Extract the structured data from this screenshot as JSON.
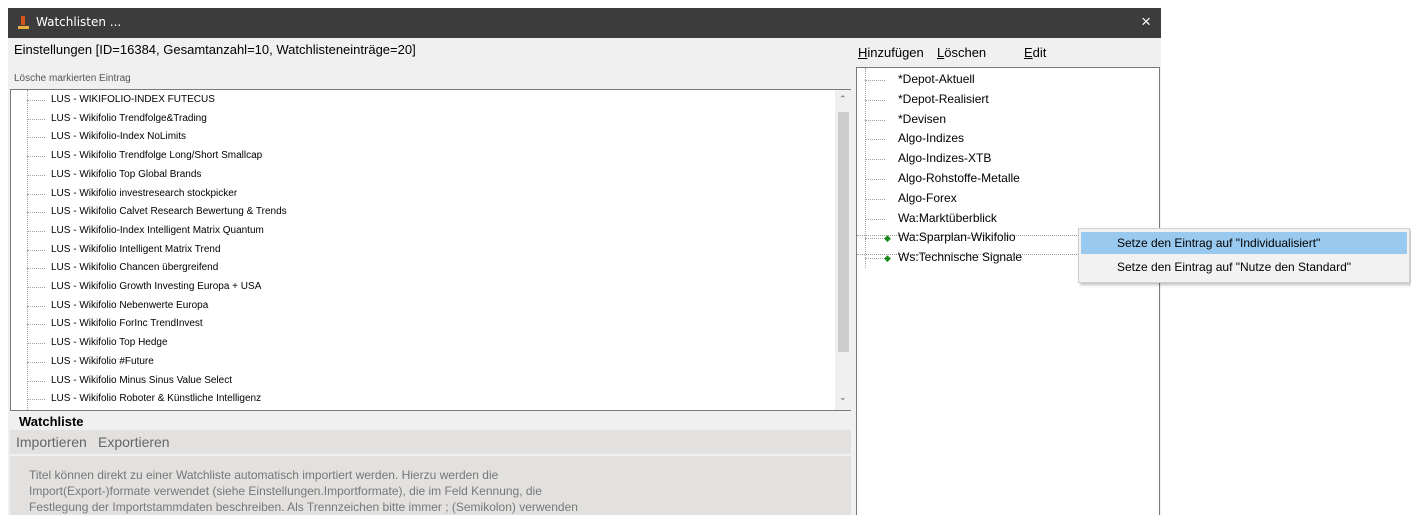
{
  "window": {
    "title": "Watchlisten ...",
    "close_icon": "×"
  },
  "settings": {
    "header": "Einstellungen [ID=16384, Gesamtanzahl=10, Watchlisteneinträge=20]",
    "delete_marked": "Lösche markierten Eintrag"
  },
  "entries": [
    "LUS - WIKIFOLIO-INDEX FUTECUS",
    "LUS - Wikifolio Trendfolge&Trading",
    "LUS - Wikifolio-Index NoLimits",
    "LUS - Wikifolio Trendfolge Long/Short Smallcap",
    "LUS - Wikifolio Top Global Brands",
    "LUS - Wikifolio investresearch stockpicker",
    "LUS - Wikifolio Calvet Research Bewertung & Trends",
    "LUS - Wikifolio-Index Intelligent Matrix Quantum",
    "LUS - Wikifolio Intelligent Matrix Trend",
    "LUS - Wikifolio Chancen übergreifend",
    "LUS - Wikifolio Growth Investing Europa + USA",
    "LUS - Wikifolio Nebenwerte Europa",
    "LUS - Wikifolio ForInc TrendInvest",
    "LUS - Wikifolio Top Hedge",
    "LUS - Wikifolio #Future",
    "LUS - Wikifolio Minus Sinus Value Select",
    "LUS - Wikifolio Roboter & Künstliche Intelligenz"
  ],
  "watchliste": {
    "title": "Watchliste",
    "import_label": "Importieren",
    "export_label": "Exportieren",
    "help_lines": [
      "Titel können direkt zu einer Watchliste automatisch importiert werden. Hierzu werden die",
      "Import(Export-)formate verwendet (siehe Einstellungen.Importformate), die im Feld Kennung, die",
      "Festlegung der Importstammdaten beschreiben. Als Trennzeichen bitte immer ; (Semikolon) verwenden"
    ]
  },
  "menu": {
    "add": {
      "first": "H",
      "rest": "inzufügen"
    },
    "delete": {
      "first": "L",
      "rest": "öschen"
    },
    "edit": {
      "first": "E",
      "rest": "dit"
    }
  },
  "watchlists": [
    {
      "label": "*Depot-Aktuell",
      "marker": ""
    },
    {
      "label": "*Depot-Realisiert",
      "marker": ""
    },
    {
      "label": "*Devisen",
      "marker": ""
    },
    {
      "label": "Algo-Indizes",
      "marker": ""
    },
    {
      "label": "Algo-Indizes-XTB",
      "marker": ""
    },
    {
      "label": "Algo-Rohstoffe-Metalle",
      "marker": ""
    },
    {
      "label": "Algo-Forex",
      "marker": ""
    },
    {
      "label": "Wa:Marktüberblick",
      "marker": ""
    },
    {
      "label": "Wa:Sparplan-Wikifolio",
      "marker": "diamond"
    },
    {
      "label": "Ws:Technische Signale",
      "marker": "diamond"
    }
  ],
  "context_menu": [
    "Setze den Eintrag auf \"Individualisiert\"",
    "Setze den Eintrag auf \"Nutze den Standard\""
  ],
  "colors": {
    "titlebar": "#3c3c3c",
    "menu_highlight": "#99c9ef",
    "marker": "#1a8a1a"
  }
}
